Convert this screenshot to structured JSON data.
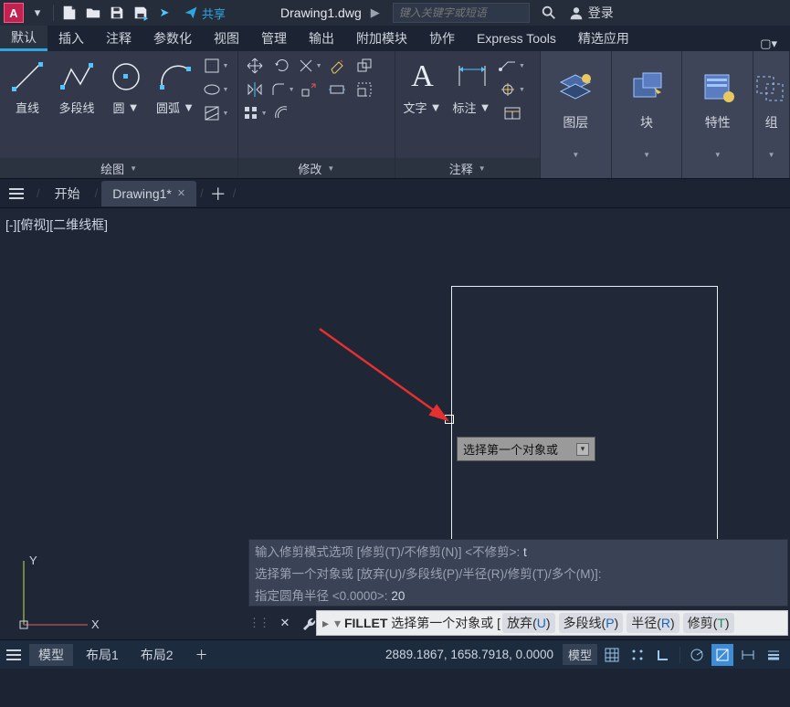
{
  "qat": {
    "app_letter": "A",
    "share": "共享",
    "filename": "Drawing1.dwg",
    "search_placeholder": "键入关键字或短语",
    "login": "登录"
  },
  "tabs": {
    "items": [
      "默认",
      "插入",
      "注释",
      "参数化",
      "视图",
      "管理",
      "输出",
      "附加模块",
      "协作",
      "Express Tools",
      "精选应用"
    ],
    "active_index": 0
  },
  "ribbon": {
    "draw": {
      "title": "绘图",
      "line": "直线",
      "polyline": "多段线",
      "circle": "圆",
      "arc": "圆弧"
    },
    "modify": {
      "title": "修改"
    },
    "annotate": {
      "title": "注释",
      "text": "文字",
      "dimension": "标注"
    },
    "layer": {
      "title": "图层"
    },
    "block": {
      "title": "块"
    },
    "properties": {
      "title": "特性"
    },
    "group": {
      "title": "组"
    }
  },
  "filetabs": {
    "start": "开始",
    "drawing": "Drawing1*"
  },
  "canvas": {
    "viewlabel": "[-][俯视][二维线框]",
    "tooltip": "选择第一个对象或"
  },
  "history": {
    "l1_a": "输入修剪模式选项 [修剪(T)/不修剪(N)] <不修剪>: ",
    "l1_b": "t",
    "l2": "选择第一个对象或 [放弃(U)/多段线(P)/半径(R)/修剪(T)/多个(M)]:",
    "l3_a": "指定圆角半径 <0.0000>: ",
    "l3_b": "20"
  },
  "cmd": {
    "name": "FILLET",
    "prompt": "选择第一个对象或",
    "opts": {
      "u_t": "放弃",
      "u_k": "U",
      "p_t": "多段线",
      "p_k": "P",
      "r_t": "半径",
      "r_k": "R",
      "t_t": "修剪",
      "t_k": "T"
    }
  },
  "status": {
    "model": "模型",
    "layout1": "布局1",
    "layout2": "布局2",
    "coords": "2889.1867, 1658.7918, 0.0000",
    "model_badge": "模型"
  }
}
